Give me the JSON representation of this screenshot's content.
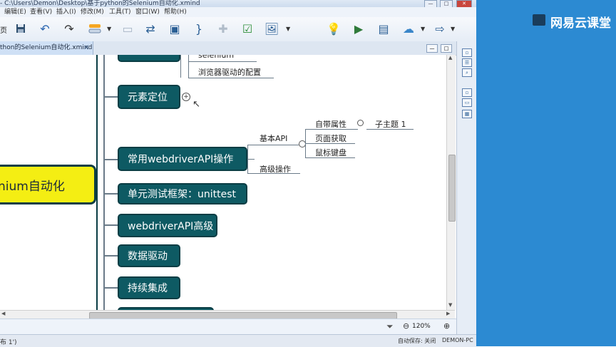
{
  "window": {
    "title": "- C:\\Users\\Demon\\Desktop\\基于python的Selenium自动化.xmind"
  },
  "menu": [
    "编辑(E)",
    "查看(V)",
    "插入(I)",
    "修改(M)",
    "工具(T)",
    "窗口(W)",
    "帮助(H)"
  ],
  "toolbar": {
    "icons": [
      "save-icon",
      "undo-icon",
      "redo-icon",
      "topic-icon",
      "callout-icon",
      "relationship-icon",
      "boundary-icon",
      "summary-icon",
      "marker-icon",
      "task-icon",
      "image-icon",
      "idea-icon",
      "presentation-icon",
      "layout-icon",
      "upload-icon",
      "export-icon"
    ],
    "left_partial": "页"
  },
  "tab": {
    "label": "thon的Selenium自动化.xmind",
    "close": "✕"
  },
  "mindmap": {
    "central": "nium自动化",
    "branches": [
      "元素定位",
      "常用webdriverAPI操作",
      "单元测试框架：unittest",
      "webdriverAPI高级",
      "数据驱动",
      "持续集成"
    ],
    "top_subtopics": [
      "selenium",
      "浏览器驱动的配置"
    ],
    "webdriver_children": [
      "基本API",
      "高级操作"
    ],
    "basic_api_children": [
      "自带属性",
      "页面获取",
      "鼠标键盘"
    ],
    "attr_child": "子主题 1",
    "collapse_marker": "+"
  },
  "status": {
    "zoom": "120%",
    "zoom_out": "⊖",
    "zoom_in": "⊕",
    "left_text": "布 1')",
    "autosave": "自动保存: 关闭",
    "user": "DEMON-PC"
  },
  "watermark": {
    "brand": "网易云课堂"
  },
  "colors": {
    "topic_fill": "#0e5a63",
    "central_fill": "#f4ee13",
    "brand_blue": "#2c8ad2"
  }
}
